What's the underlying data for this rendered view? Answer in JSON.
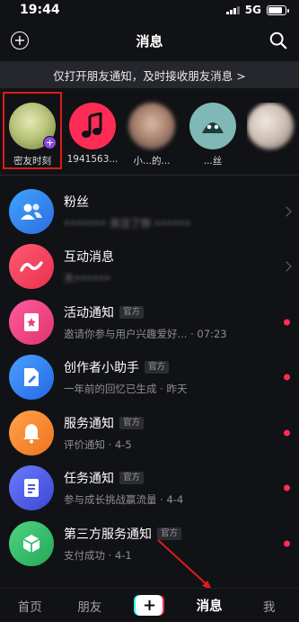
{
  "status_bar": {
    "time": "19:44",
    "network": "5G",
    "battery_level": 0.85
  },
  "nav": {
    "title": "消息"
  },
  "banner": {
    "text": "仅打开朋友通知，及时接收朋友消息 >"
  },
  "stories": [
    {
      "label": "密友时刻",
      "highlighted": true
    },
    {
      "label": "1941563...",
      "icon": "music-note-icon"
    },
    {
      "label": "小...的..."
    },
    {
      "label": "...丝"
    },
    {
      "label": ""
    }
  ],
  "messages": [
    {
      "title": "粉丝",
      "subtitle": "••••••• 关注了你 ••••••",
      "icon": "fans-icon",
      "color": "#2f80ed",
      "right": "chevron"
    },
    {
      "title": "互动消息",
      "subtitle": "大••••••",
      "icon": "interaction-icon",
      "color": "#f0415f",
      "right": "chevron"
    },
    {
      "title": "活动通知",
      "tag": "官方",
      "subtitle": "邀请你参与用户兴趣爱好... · 07:23",
      "icon": "activity-icon",
      "color": "#e8407e",
      "right": "dot"
    },
    {
      "title": "创作者小助手",
      "tag": "官方",
      "subtitle": "一年前的回忆已生成 · 昨天",
      "icon": "creator-icon",
      "color": "#2f7cf2",
      "right": "dot"
    },
    {
      "title": "服务通知",
      "tag": "官方",
      "subtitle": "评价通知 · 4-5",
      "icon": "bell-icon",
      "color": "#f2862b",
      "right": "dot"
    },
    {
      "title": "任务通知",
      "tag": "官方",
      "subtitle": "参与成长挑战赢流量 · 4-4",
      "icon": "task-icon",
      "color": "#4a5ae0",
      "right": "dot"
    },
    {
      "title": "第三方服务通知",
      "tag": "官方",
      "subtitle": "支付成功 · 4-1",
      "icon": "cube-icon",
      "color": "#33c06a",
      "right": "dot"
    }
  ],
  "tabs": [
    {
      "label": "首页"
    },
    {
      "label": "朋友"
    },
    {
      "label": "+"
    },
    {
      "label": "消息",
      "active": true
    },
    {
      "label": "我"
    }
  ],
  "colors": {
    "accent": "#fe2c55",
    "highlight_box": "#e01a1a",
    "purple": "#8a4bdf"
  }
}
